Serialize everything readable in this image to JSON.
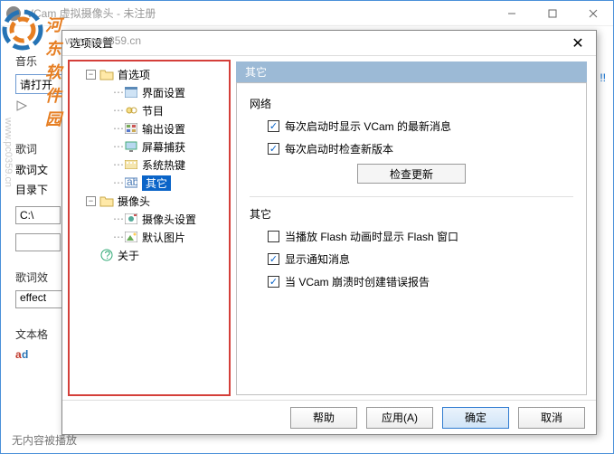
{
  "watermark": {
    "brand": "河东软件园",
    "url": "www.pc0359.cn"
  },
  "main_window": {
    "title": "VCam 虚拟摄像头 - 未注册",
    "music_label": "音乐",
    "music_input": "请打开",
    "lyrics_label": "歌词",
    "lyrics_line1": "歌词文",
    "lyrics_line2": "目录下",
    "path_value": "C:\\",
    "effect_label": "歌词效",
    "effect_value": "effect",
    "file_label": "文本格",
    "status": "无内容被播放",
    "register": "!!"
  },
  "dialog": {
    "title": "选项设置",
    "tree": {
      "prefs": "首选项",
      "ui": "界面设置",
      "program": "节目",
      "output": "输出设置",
      "capture": "屏幕捕获",
      "hotkey": "系统热键",
      "other": "其它",
      "camera": "摄像头",
      "camcfg": "摄像头设置",
      "defimg": "默认图片",
      "about": "关于"
    },
    "panel": {
      "heading": "其它",
      "group_network": "网络",
      "chk_latest_news": "每次启动时显示 VCam 的最新消息",
      "chk_check_update": "每次启动时检查新版本",
      "btn_check_update": "检查更新",
      "group_other": "其它",
      "chk_flash": "当播放 Flash 动画时显示 Flash 窗口",
      "chk_notify": "显示通知消息",
      "chk_crash": "当 VCam 崩溃时创建错误报告"
    },
    "footer": {
      "help": "帮助",
      "apply": "应用(A)",
      "ok": "确定",
      "cancel": "取消"
    }
  }
}
